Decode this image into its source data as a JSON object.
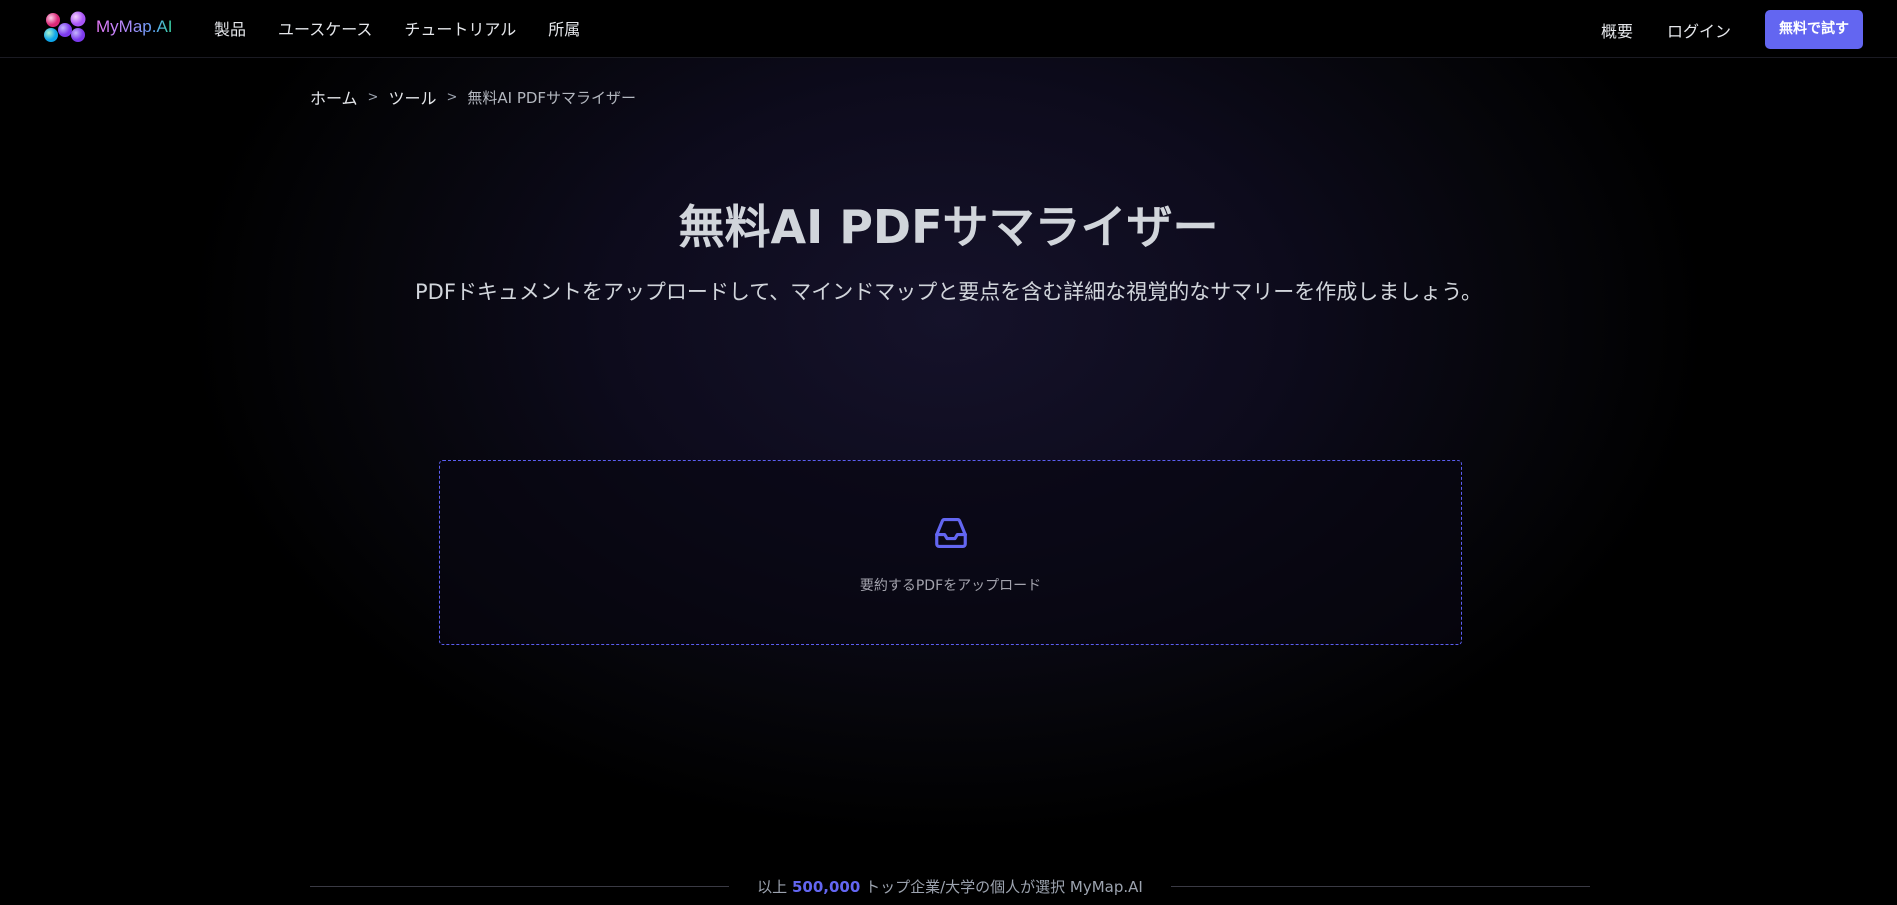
{
  "header": {
    "logo_text": "MyMap.AI",
    "nav": [
      "製品",
      "ユースケース",
      "チュートリアル",
      "所属"
    ],
    "overview_label": "概要",
    "login_label": "ログイン",
    "cta_label": "無料で試す"
  },
  "breadcrumb": {
    "home": "ホーム",
    "tools": "ツール",
    "current": "無料AI PDFサマライザー",
    "separator": ">"
  },
  "hero": {
    "title": "無料AI PDFサマライザー",
    "subtitle": "PDFドキュメントをアップロードして、マインドマップと要点を含む詳細な視覚的なサマリーを作成しましょう。"
  },
  "upload": {
    "icon": "inbox-icon",
    "label": "要約するPDFをアップロード"
  },
  "trust": {
    "prefix": "以上",
    "number": "500,000",
    "suffix": "トップ企業/大学の個人が選択 MyMap.AI"
  },
  "colors": {
    "accent": "#6366f1",
    "background": "#000000",
    "text": "#e5e7eb"
  }
}
